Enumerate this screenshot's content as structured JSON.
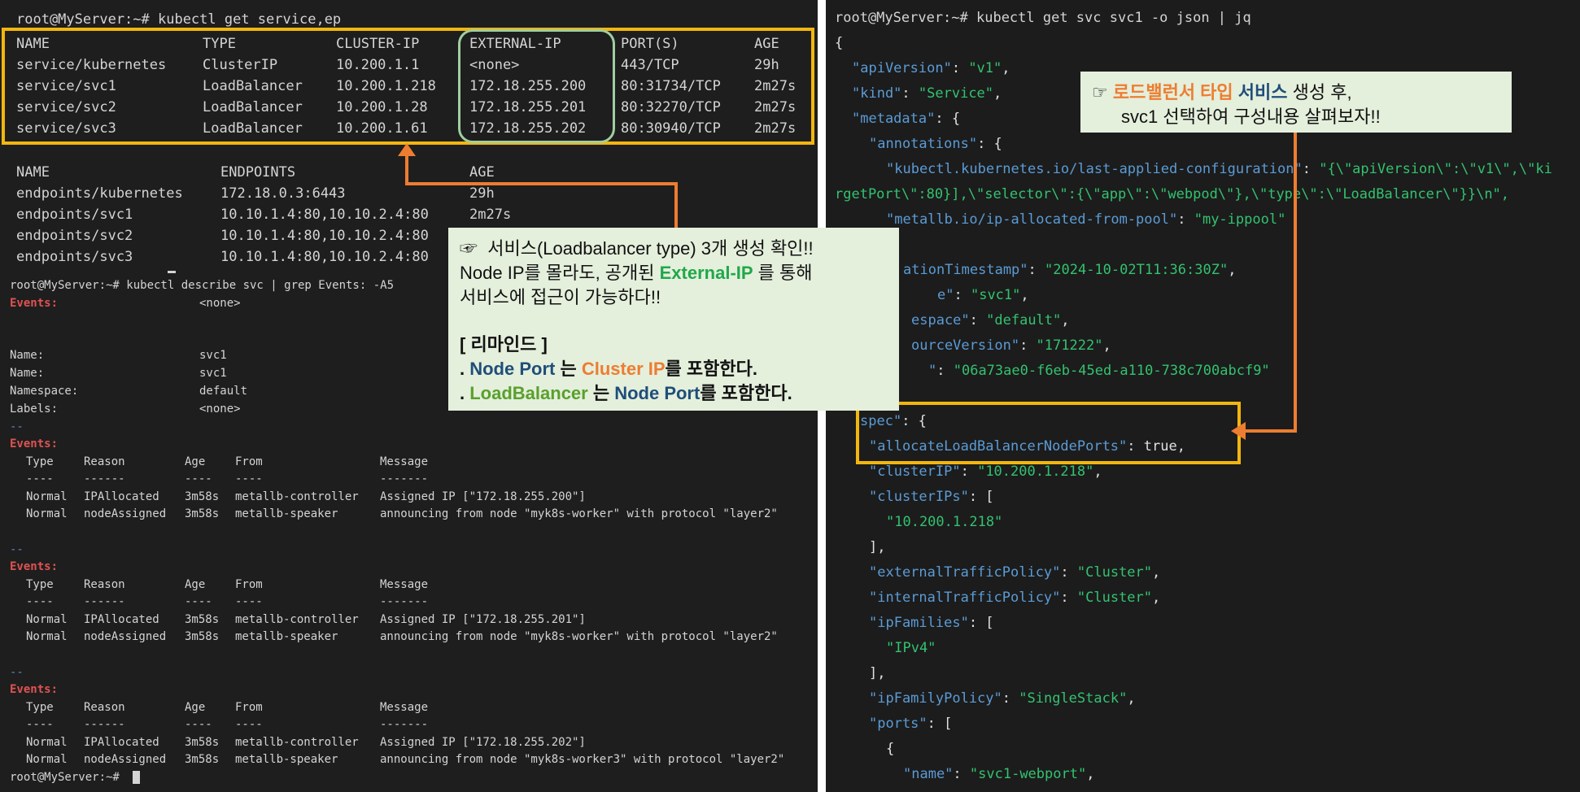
{
  "left": {
    "cmd_get": "root@MyServer:~# kubectl get service,ep",
    "svc_headers": [
      "NAME",
      "TYPE",
      "CLUSTER-IP",
      "EXTERNAL-IP",
      "PORT(S)",
      "AGE"
    ],
    "svc_rows": [
      [
        "service/kubernetes",
        "ClusterIP",
        "10.200.1.1",
        "<none>",
        "443/TCP",
        "29h"
      ],
      [
        "service/svc1",
        "LoadBalancer",
        "10.200.1.218",
        "172.18.255.200",
        "80:31734/TCP",
        "2m27s"
      ],
      [
        "service/svc2",
        "LoadBalancer",
        "10.200.1.28",
        "172.18.255.201",
        "80:32270/TCP",
        "2m27s"
      ],
      [
        "service/svc3",
        "LoadBalancer",
        "10.200.1.61",
        "172.18.255.202",
        "80:30940/TCP",
        "2m27s"
      ]
    ],
    "ep_headers": [
      "NAME",
      "ENDPOINTS",
      "AGE"
    ],
    "ep_rows": [
      [
        "endpoints/kubernetes",
        "172.18.0.3:6443",
        "29h"
      ],
      [
        "endpoints/svc1",
        "10.10.1.4:80,10.10.2.4:80",
        "2m27s"
      ],
      [
        "endpoints/svc2",
        "10.10.1.4:80,10.10.2.4:80",
        ""
      ],
      [
        "endpoints/svc3",
        "10.10.1.4:80,10.10.2.4:80",
        ""
      ]
    ],
    "cmd_describe": "root@MyServer:~# kubectl describe svc | grep Events: -A5",
    "events_label": "Events:",
    "none_value": "<none>",
    "name_label": "Name:",
    "name_value": "svc1",
    "namespace_label": "Namespace:",
    "namespace_value": "default",
    "labels_label": "Labels:",
    "separator": "--",
    "ev_headers": [
      "Type",
      "Reason",
      "Age",
      "From",
      "Message"
    ],
    "ev_under": [
      "----",
      "------",
      "----",
      "----",
      "-------"
    ],
    "ev_blocks": [
      [
        [
          "Normal",
          "IPAllocated",
          "3m58s",
          "metallb-controller",
          "Assigned IP [\"172.18.255.200\"]"
        ],
        [
          "Normal",
          "nodeAssigned",
          "3m58s",
          "metallb-speaker",
          "announcing from node \"myk8s-worker\" with protocol \"layer2\""
        ]
      ],
      [
        [
          "Normal",
          "IPAllocated",
          "3m58s",
          "metallb-controller",
          "Assigned IP [\"172.18.255.201\"]"
        ],
        [
          "Normal",
          "nodeAssigned",
          "3m58s",
          "metallb-speaker",
          "announcing from node \"myk8s-worker\" with protocol \"layer2\""
        ]
      ],
      [
        [
          "Normal",
          "IPAllocated",
          "3m58s",
          "metallb-controller",
          "Assigned IP [\"172.18.255.202\"]"
        ],
        [
          "Normal",
          "nodeAssigned",
          "3m58s",
          "metallb-speaker",
          "announcing from node \"myk8s-worker3\" with protocol \"layer2\""
        ]
      ]
    ],
    "prompt": "root@MyServer:~#"
  },
  "callout_left": {
    "line1_icon": "☞",
    "line1_text": "서비스(Loadbalancer type) 3개 생성 확인!!",
    "line2_a": "Node IP를 몰라도, 공개된 ",
    "line2_b": "External-IP",
    "line2_c": " 를 통해",
    "line3": "서비스에 접근이 가능하다!!",
    "reminder_title": "[ 리마인드 ]",
    "r1_a": ". ",
    "r1_b": "Node Port",
    "r1_c": " 는 ",
    "r1_d": "Cluster IP",
    "r1_e": "를 포함한다.",
    "r2_a": ". ",
    "r2_b": "LoadBalancer",
    "r2_c": " 는 ",
    "r2_d": "Node Port",
    "r2_e": "를 포함한다."
  },
  "callout_right": {
    "icon": "☞",
    "title_a": "로드밸런서 타입",
    "title_b": "서비스",
    "title_c": " 생성 후,",
    "line2": "svc1 선택하여 구성내용 살펴보자!!"
  },
  "right": {
    "cmd": "root@MyServer:~# kubectl get svc svc1 -o json | jq",
    "open_brace": "{",
    "apiVersion_key": "\"apiVersion\"",
    "apiVersion_val": "\"v1\"",
    "kind_key": "\"kind\"",
    "kind_val": "\"Service\"",
    "metadata_key": "\"metadata\"",
    "annotations_key": "\"annotations\"",
    "lastapplied_key": "\"kubectl.kubernetes.io/last-applied-configuration\"",
    "lastapplied_val": "\"{\\\"apiVersion\\\":\\\"v1\\\",\\\"ki",
    "lastapplied_wrap": "rgetPort\\\":80}],\\\"selector\\\":{\\\"app\\\":\\\"webpod\\\"},\\\"type\\\":\\\"LoadBalancer\\\"}}\\n\",",
    "pool_key": "\"metallb.io/ip-allocated-from-pool\"",
    "pool_val": "\"my-ippool\"",
    "created_key": "ationTimestamp\"",
    "created_val": "\"2024-10-02T11:36:30Z\"",
    "name_key": "e\"",
    "name_val": "\"svc1\"",
    "ns_key": "espace\"",
    "ns_val": "\"default\"",
    "rv_key": "ourceVersion\"",
    "rv_val": "\"171222\"",
    "uid_key": "\"",
    "uid_val": "\"06a73ae0-f6eb-45ed-a110-738c700abcf9\"",
    "spec_key": "spec\"",
    "alloc_key": "\"allocateLoadBalancerNodePorts\"",
    "alloc_val": "true",
    "clusterIP_key": "\"clusterIP\"",
    "clusterIP_val": "\"10.200.1.218\"",
    "clusterIPs_key": "\"clusterIPs\"",
    "clusterIPs_item": "\"10.200.1.218\"",
    "close_arr": "],",
    "etp_key": "\"externalTrafficPolicy\"",
    "etp_val": "\"Cluster\"",
    "itp_key": "\"internalTrafficPolicy\"",
    "itp_val": "\"Cluster\"",
    "ipf_key": "\"ipFamilies\"",
    "ipf_item": "\"IPv4\"",
    "ipfp_key": "\"ipFamilyPolicy\"",
    "ipfp_val": "\"SingleStack\"",
    "ports_key": "\"ports\"",
    "port_name_key": "\"name\"",
    "port_name_val": "\"svc1-webport\""
  },
  "colors": {
    "highlight_box": "#f2b60f",
    "external_ip_box": "#9fcf9f",
    "arrow": "#ed7d31",
    "callout_bg": "#e4efdc",
    "json_key": "#5b9bd5",
    "json_string": "#33c26f",
    "events_label": "#e05252"
  }
}
